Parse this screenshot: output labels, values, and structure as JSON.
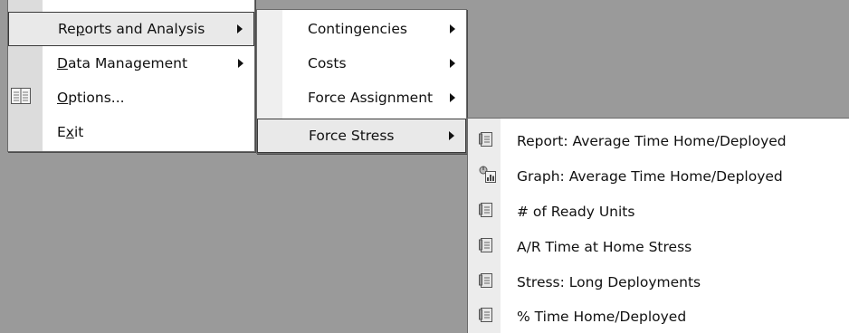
{
  "main_menu": {
    "items": [
      {
        "label_pre": "Re",
        "label_key": "p",
        "label_post": "orts and Analysis",
        "has_submenu": true,
        "highlighted": true,
        "icon": ""
      },
      {
        "label_pre": "",
        "label_key": "D",
        "label_post": "ata Management",
        "has_submenu": true,
        "highlighted": false,
        "icon": ""
      },
      {
        "label_pre": "",
        "label_key": "O",
        "label_post": "ptions...",
        "has_submenu": false,
        "highlighted": false,
        "icon": "options-book-icon"
      },
      {
        "label_pre": "E",
        "label_key": "x",
        "label_post": "it",
        "has_submenu": false,
        "highlighted": false,
        "icon": ""
      }
    ]
  },
  "reports_submenu": {
    "items": [
      {
        "label": "Contingencies",
        "has_submenu": true,
        "highlighted": false
      },
      {
        "label": "Costs",
        "has_submenu": true,
        "highlighted": false
      },
      {
        "label": "Force Assignment",
        "has_submenu": true,
        "highlighted": false
      },
      {
        "label": "Force Stress",
        "has_submenu": true,
        "highlighted": true
      }
    ]
  },
  "force_stress_submenu": {
    "items": [
      {
        "label": "Report: Average Time Home/Deployed",
        "icon": "report-icon"
      },
      {
        "label": "Graph: Average Time Home/Deployed",
        "icon": "graph-report-icon"
      },
      {
        "label": "# of Ready Units",
        "icon": "report-icon"
      },
      {
        "label": "A/R Time at Home Stress",
        "icon": "report-icon"
      },
      {
        "label": "Stress: Long Deployments",
        "icon": "report-icon"
      },
      {
        "label": "% Time Home/Deployed",
        "icon": "report-icon"
      }
    ]
  },
  "colors": {
    "desktop_background": "#9a9a9a",
    "menu_background": "#ffffff",
    "gutter": "#dcdcdc",
    "highlight": "#e9e9e9",
    "highlight_border": "#3a3a3a"
  }
}
